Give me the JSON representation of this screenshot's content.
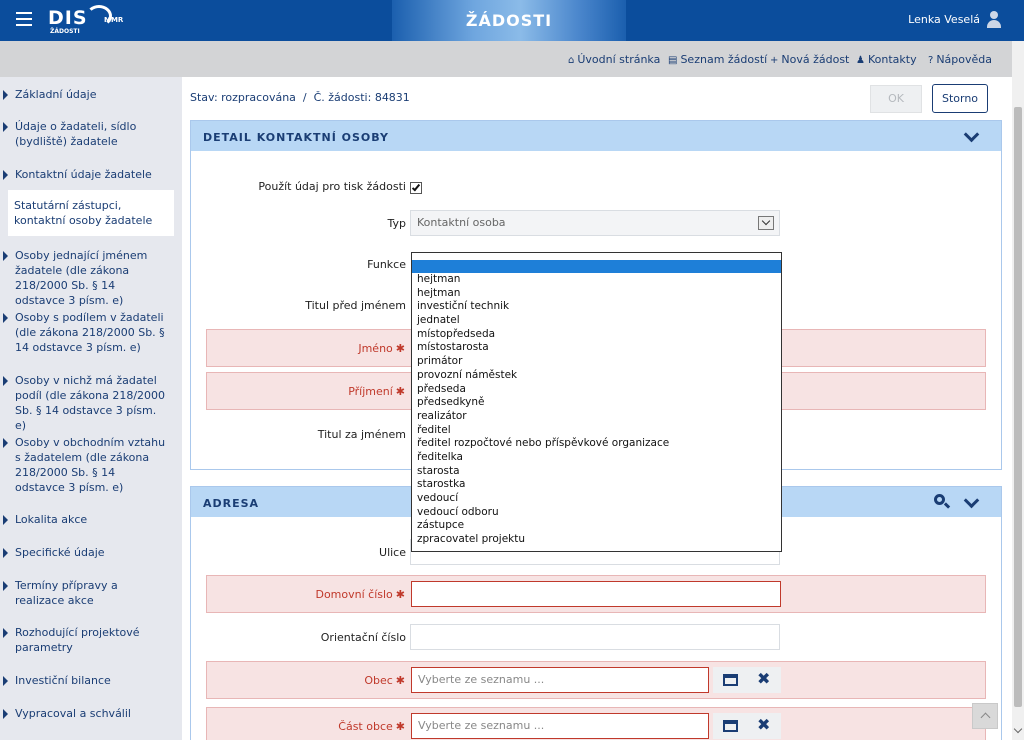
{
  "header": {
    "logo_text": "DIS",
    "logo_sub": "ŽÁDOSTI",
    "logo_mmr": "MMR",
    "banner_title": "ŽÁDOSTI",
    "user_name": "Lenka Veselá"
  },
  "nav": {
    "home": "Úvodní stránka",
    "list": "Seznam žádostí",
    "new": "Nová žádost",
    "contacts": "Kontakty",
    "help": "Nápověda"
  },
  "sidebar": {
    "items": [
      {
        "label": "Základní údaje"
      },
      {
        "label": "Údaje o žadateli, sídlo (bydliště) žadatele"
      },
      {
        "label": "Kontaktní údaje žadatele"
      },
      {
        "label": "Statutární zástupci, kontaktní osoby žadatele"
      },
      {
        "label": "Osoby jednající jménem žadatele (dle zákona 218/2000 Sb. § 14 odstavce 3 písm. e)"
      },
      {
        "label": "Osoby s podílem v žadateli (dle zákona 218/2000 Sb. § 14 odstavce 3 písm. e)"
      },
      {
        "label": "Osoby v nichž má žadatel podíl (dle zákona 218/2000 Sb. § 14 odstavce 3 písm. e)"
      },
      {
        "label": "Osoby v obchodním vztahu s žadatelem (dle zákona 218/2000 Sb. § 14 odstavce 3 písm. e)"
      },
      {
        "label": "Lokalita akce"
      },
      {
        "label": "Specifické údaje"
      },
      {
        "label": "Termíny přípravy a realizace akce"
      },
      {
        "label": "Rozhodující projektové parametry"
      },
      {
        "label": "Investiční bilance"
      },
      {
        "label": "Vypracoval a schválil"
      }
    ]
  },
  "status": {
    "text": "Stav: rozpracována  /  Č. žádosti: 84831",
    "ok_label": "OK",
    "storno_label": "Storno"
  },
  "contact_panel": {
    "title": "DETAIL KONTAKTNÍ OSOBY",
    "print_label": "Použít údaj pro tisk žádosti",
    "print_checked": true,
    "type_label": "Typ",
    "type_value": "Kontaktní osoba",
    "function_label": "Funkce",
    "title_before_label": "Titul před jménem",
    "first_name_label": "Jméno",
    "last_name_label": "Příjmení",
    "title_after_label": "Titul za jménem",
    "required_mark": "✱"
  },
  "function_dropdown": {
    "selected": "",
    "options": [
      "hejtman",
      "hejtman",
      "investiční technik",
      "jednatel",
      "místopředseda",
      "místostarosta",
      "primátor",
      "provozní náměstek",
      "předseda",
      "předsedkyně",
      "realizátor",
      "ředitel",
      "ředitel rozpočtové nebo příspěvkové organizace",
      "ředitelka",
      "starosta",
      "starostka",
      "vedoucí",
      "vedoucí odboru",
      "zástupce",
      "zpracovatel projektu"
    ]
  },
  "address_panel": {
    "title": "ADRESA",
    "street_label": "Ulice",
    "house_no_label": "Domovní číslo",
    "orient_no_label": "Orientační číslo",
    "city_label": "Obec",
    "city_placeholder": "Vyberte ze seznamu ...",
    "part_label": "Část obce",
    "part_placeholder": "Vyberte ze seznamu ...",
    "required_mark": "✱"
  },
  "colors": {
    "topbar": "#0b4d9c",
    "accent": "#1a3d74",
    "panel_head": "#b8d7f5",
    "required_bg": "#f7e3e3",
    "required_text": "#c0392b"
  }
}
